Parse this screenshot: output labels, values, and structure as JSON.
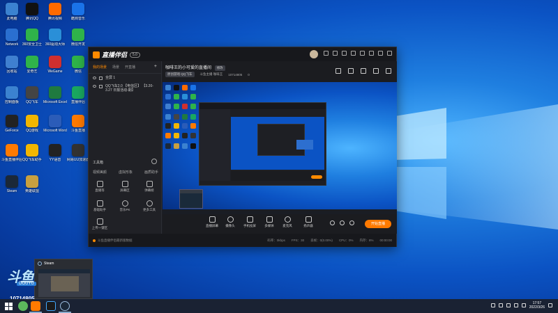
{
  "colors": {
    "accent": "#ff7a00",
    "desktop": "#0b53c4",
    "window_bg": "#1e1f24"
  },
  "desktop_icons": [
    {
      "label": "此电脑",
      "color": "#3b82d0"
    },
    {
      "label": "腾讯QQ",
      "color": "#111111"
    },
    {
      "label": "腾讯视频",
      "color": "#ff6a00"
    },
    {
      "label": "酷狗音乐",
      "color": "#1a73e8"
    },
    {
      "label": "Network",
      "color": "#2a6fd0"
    },
    {
      "label": "360安全卫士",
      "color": "#2fb34a"
    },
    {
      "label": "360驱动大师",
      "color": "#2a8fd8"
    },
    {
      "label": "微信开发",
      "color": "#2fb34a"
    },
    {
      "label": "回收站",
      "color": "#3f7fd0"
    },
    {
      "label": "爱奇艺",
      "color": "#2fb34a"
    },
    {
      "label": "WeGame",
      "color": "#d02f2f"
    },
    {
      "label": "微信",
      "color": "#2fb34a"
    },
    {
      "label": "控制面板",
      "color": "#3b82d0"
    },
    {
      "label": "QQ飞车",
      "color": "#444444"
    },
    {
      "label": "Microsoft Excel",
      "color": "#1f7a3f"
    },
    {
      "label": "直播伴侣",
      "color": "#1aa860"
    },
    {
      "label": "GeForce",
      "color": "#222222"
    },
    {
      "label": "QQ游戏",
      "color": "#f2b600"
    },
    {
      "label": "Microsoft Word",
      "color": "#2b5cb8"
    },
    {
      "label": "斗鱼直播",
      "color": "#ff7a00"
    },
    {
      "label": "斗鱼直播伴侣",
      "color": "#ff7a00"
    },
    {
      "label": "QQ飞车助手",
      "color": "#f2b600"
    },
    {
      "label": "YY语音",
      "color": "#222222"
    },
    {
      "label": "网易UU加速器",
      "color": "#333333"
    },
    {
      "label": "Steam",
      "color": "#1b2838"
    },
    {
      "label": "英雄联盟",
      "color": "#c8a040"
    }
  ],
  "app": {
    "name": "直播伴侣",
    "version": "5.0",
    "tabs": [
      "我的场景",
      "场景",
      "开直播"
    ],
    "scenes": [
      {
        "label": "全屏 1"
      },
      {
        "label": "QQ飞车2.0 【电信区】 【3.20-3.27 日报活动-期】"
      }
    ],
    "tools_title": "工具箱",
    "tool_row": [
      "视频美颜",
      "虚拟形象",
      "画质助手"
    ],
    "tools": [
      {
        "label": "直播等"
      },
      {
        "label": "屏幕区"
      },
      {
        "label": "弹幕姬"
      },
      {
        "label": "基础助手"
      },
      {
        "label": "音乐PK"
      },
      {
        "label": "更多工具"
      },
      {
        "label": "上传一键区"
      }
    ],
    "room_title": "咖啡王的小可爱的直播间",
    "room_edit": "修改",
    "room_tag": "原创游戏·QQ飞车",
    "room_owner": "斗鱼主播 咖啡王",
    "room_id": "10714805",
    "room_fans": "0",
    "controls": [
      "直播屏幕",
      "摄像头",
      "手机投屏",
      "多媒体",
      "麦克风",
      "扬声器"
    ],
    "start_live": "开始直播",
    "status_msg": "斗鱼直播伴侣最新版数据",
    "status_items": [
      "码率：0kbps",
      "FPS：30",
      "丢帧：0(0.00%)",
      "CPU：0%",
      "内存：8%",
      "00:00:00"
    ]
  },
  "steam_popup": {
    "title": "Steam"
  },
  "watermark": {
    "logo": "斗鱼",
    "sub": "DOUYU",
    "id": "10714805"
  },
  "taskbar": {
    "time": "17:57",
    "date": "2022/3/26"
  }
}
